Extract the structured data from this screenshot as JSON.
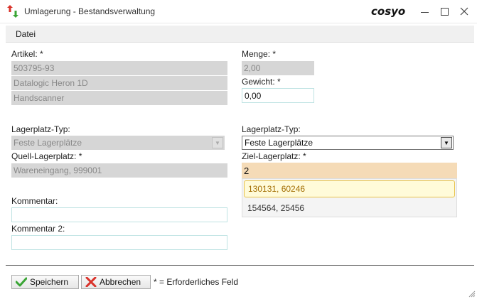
{
  "window": {
    "title": "Umlagerung - Bestandsverwaltung",
    "brand": "cosyo",
    "icons": [
      "up-down-arrows-icon",
      "minimize-icon",
      "maximize-icon",
      "close-icon"
    ]
  },
  "menu": {
    "file": "Datei"
  },
  "left": {
    "article_label": "Artikel: *",
    "article_number": "503795-93",
    "article_name": "Datalogic Heron 1D",
    "article_type": "Handscanner",
    "location_type_label": "Lagerplatz-Typ:",
    "location_type_value": "Feste Lagerplätze",
    "source_label": "Quell-Lagerplatz: *",
    "source_value": "Wareneingang, 999001",
    "comment_label": "Kommentar:",
    "comment_value": "",
    "comment2_label": "Kommentar 2:",
    "comment2_value": ""
  },
  "right": {
    "quantity_label": "Menge: *",
    "quantity_value": "2,00",
    "weight_label": "Gewicht: *",
    "weight_value": "0,00",
    "location_type_label": "Lagerplatz-Typ:",
    "location_type_value": "Feste Lagerplätze",
    "target_label": "Ziel-Lagerplatz: *",
    "target_value": "2",
    "suggestions": [
      "130131, 60246",
      "154564, 25456"
    ]
  },
  "footer": {
    "save_label": "Speichern",
    "cancel_label": "Abbrechen",
    "required_note": "* = Erforderliches Feld"
  },
  "colors": {
    "readonly_bg": "#d6d6d6",
    "combo_highlight": "#f5dbb7",
    "suggestion_selected_bg": "#fffbd9",
    "suggestion_selected_text": "#a26d00"
  }
}
